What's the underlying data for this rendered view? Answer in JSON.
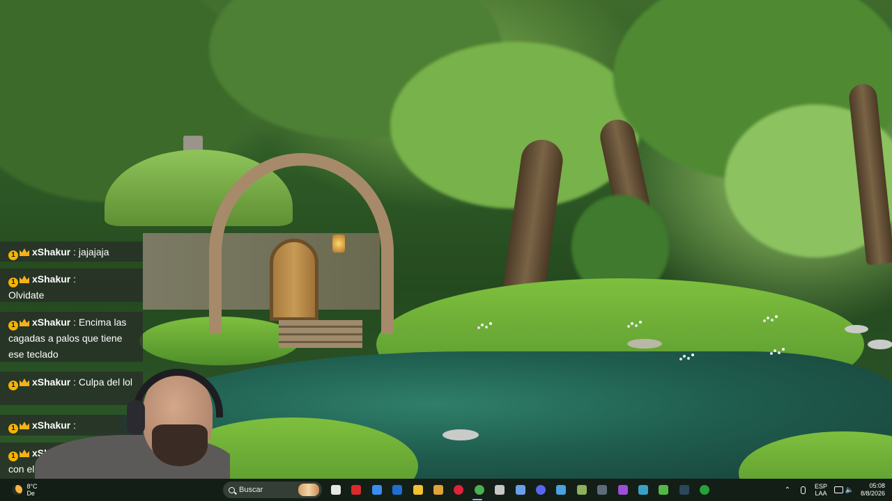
{
  "chat": {
    "messages": [
      {
        "user": "xShakur",
        "sep": " : ",
        "text": "jajajaja",
        "badge": "1"
      },
      {
        "user": "xShakur",
        "sep": " :",
        "text": "Olvidate",
        "badge": "1"
      },
      {
        "user": "xShakur",
        "sep": " : ",
        "text": "Encima las cagadas a palos que tiene ese teclado",
        "badge": "1"
      },
      {
        "user": "xShakur",
        "sep": " : ",
        "text": "Culpa del lol",
        "badge": "1"
      },
      {
        "user": "xShakur",
        "sep": " :",
        "text": "",
        "badge": "1"
      },
      {
        "user": "xShakur",
        "sep": "",
        "text": "con el st",
        "badge": "1"
      }
    ]
  },
  "taskbar": {
    "weather": {
      "temp": "8°C",
      "desc": "De"
    },
    "search": {
      "placeholder": "Buscar"
    },
    "apps": [
      {
        "name": "task-view-icon",
        "color": "#e6e6e6"
      },
      {
        "name": "redapp-icon",
        "color": "#d92b2b"
      },
      {
        "name": "store-icon",
        "color": "#3a8df0"
      },
      {
        "name": "outlook-icon",
        "color": "#1f6fd1"
      },
      {
        "name": "file-explorer-icon",
        "color": "#f2c230"
      },
      {
        "name": "editor-icon",
        "color": "#e0a23a"
      },
      {
        "name": "media-player-icon",
        "color": "#e0223a"
      },
      {
        "name": "chrome-icon",
        "color": "#4caf50"
      },
      {
        "name": "settings-icon",
        "color": "#c7c7c7"
      },
      {
        "name": "notepad-icon",
        "color": "#6aa0e8"
      },
      {
        "name": "discord-icon",
        "color": "#5865f2"
      },
      {
        "name": "photos-icon",
        "color": "#4aa3df"
      },
      {
        "name": "gpu-icon",
        "color": "#8fb05a"
      },
      {
        "name": "terminal-icon",
        "color": "#5d6b7a"
      },
      {
        "name": "podcast-icon",
        "color": "#9b4fd6"
      },
      {
        "name": "vpn-icon",
        "color": "#3aa0c8"
      },
      {
        "name": "android-icon",
        "color": "#54b848"
      },
      {
        "name": "steam-icon",
        "color": "#2a475e"
      },
      {
        "name": "xbox-icon",
        "color": "#27a13a"
      }
    ],
    "tray": {
      "lang_top": "ESP",
      "lang_bottom": "LAA",
      "time": "05:08",
      "date": "8/8/2026"
    }
  }
}
